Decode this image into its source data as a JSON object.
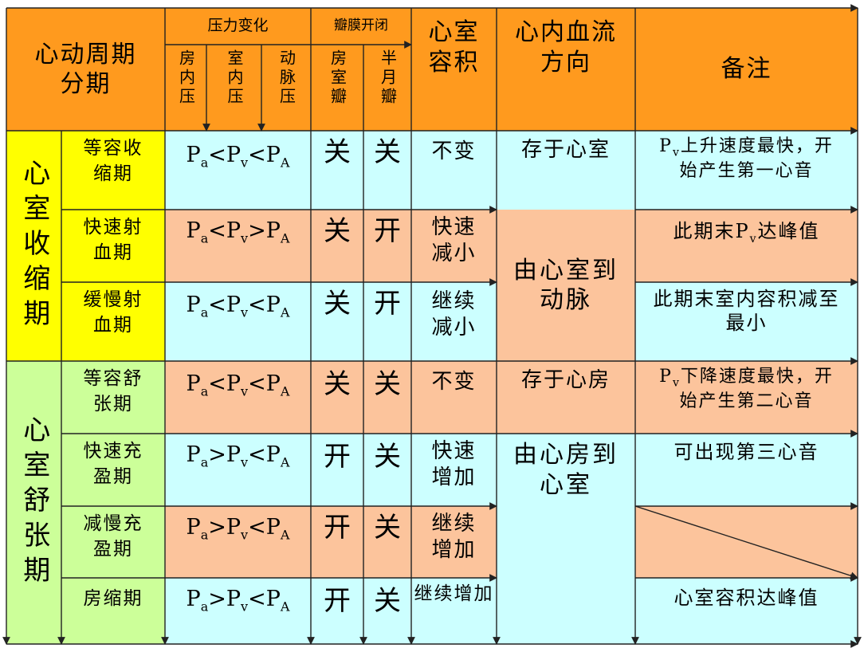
{
  "header": {
    "phase": "心动周期分期",
    "pressure": "压力变化",
    "atrial_pressure": "房内压",
    "ventricular_pressure": "室内压",
    "arterial_pressure": "动脉压",
    "valves": "瓣膜开闭",
    "av_valve": "房室瓣",
    "semilunar_valve": "半月瓣",
    "volume": "心室容积",
    "flow": "心内血流方向",
    "remarks": "备注"
  },
  "groups": {
    "systole": "心室收缩期",
    "diastole": "心室舒张期"
  },
  "rows": [
    {
      "phase": "等容收缩期",
      "p1": "P",
      "s1": "a",
      "op1": "<",
      "p2": "P",
      "s2": "v",
      "op2": "<",
      "p3": "P",
      "s3": "A",
      "av": "关",
      "sl": "关",
      "volume": "不变",
      "flow": "存于心室",
      "note_pre": "P",
      "note_sub": "v",
      "note_post": "上升速度最快，开始产生第一心音"
    },
    {
      "phase": "快速射血期",
      "p1": "P",
      "s1": "a",
      "op1": "<",
      "p2": "P",
      "s2": "v",
      "op2": ">",
      "p3": "P",
      "s3": "A",
      "av": "关",
      "sl": "开",
      "volume": "快速减小",
      "flow": "",
      "note_pre": "此期末P",
      "note_sub": "v",
      "note_post": "达峰值"
    },
    {
      "phase": "缓慢射血期",
      "p1": "P",
      "s1": "a",
      "op1": "<",
      "p2": "P",
      "s2": "v",
      "op2": "<",
      "p3": "P",
      "s3": "A",
      "av": "关",
      "sl": "开",
      "volume": "继续减小",
      "flow": "",
      "note_pre": "此期末室内容积减至最小",
      "note_sub": "",
      "note_post": ""
    },
    {
      "phase": "等容舒张期",
      "p1": "P",
      "s1": "a",
      "op1": "<",
      "p2": "P",
      "s2": "v",
      "op2": "<",
      "p3": "P",
      "s3": "A",
      "av": "关",
      "sl": "关",
      "volume": "不变",
      "flow": "存于心房",
      "note_pre": "P",
      "note_sub": "v",
      "note_post": "下降速度最快，开始产生第二心音"
    },
    {
      "phase": "快速充盈期",
      "p1": "P",
      "s1": "a",
      "op1": ">",
      "p2": "P",
      "s2": "v",
      "op2": "<",
      "p3": "P",
      "s3": "A",
      "av": "开",
      "sl": "关",
      "volume": "快速增加",
      "flow": "",
      "note_pre": "可出现第三心音",
      "note_sub": "",
      "note_post": ""
    },
    {
      "phase": "减慢充盈期",
      "p1": "P",
      "s1": "a",
      "op1": ">",
      "p2": "P",
      "s2": "v",
      "op2": "<",
      "p3": "P",
      "s3": "A",
      "av": "开",
      "sl": "关",
      "volume": "继续增加",
      "flow": "",
      "note_pre": "",
      "note_sub": "",
      "note_post": ""
    },
    {
      "phase": "房缩期",
      "p1": "P",
      "s1": "a",
      "op1": ">",
      "p2": "P",
      "s2": "v",
      "op2": "<",
      "p3": "P",
      "s3": "A",
      "av": "开",
      "sl": "关",
      "volume": "继续增加",
      "flow": "",
      "note_pre": "心室容积达峰值",
      "note_sub": "",
      "note_post": ""
    }
  ],
  "merged_flow": {
    "ejection": "由心室到动脉",
    "filling": "由心房到心室"
  },
  "colors": {
    "header": "#ff9a1e",
    "systole_group": "#ffff00",
    "diastole_group": "#ccff99",
    "cyan_row": "#ccffff",
    "peach_row": "#fcc49c"
  }
}
